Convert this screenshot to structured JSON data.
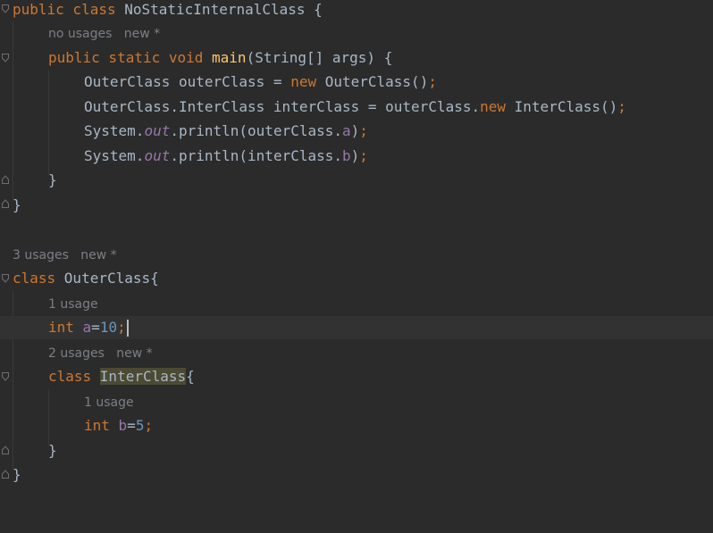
{
  "editor": {
    "colors": {
      "background": "#2b2b2b",
      "keyword": "#cc7832",
      "method": "#ffc66d",
      "field": "#9876aa",
      "number": "#6897bb",
      "text": "#a9b7c6",
      "hint": "#7b7f86"
    },
    "hints": {
      "main_usages": "no usages",
      "main_new": "new *",
      "outer_usages": "3 usages",
      "outer_new": "new *",
      "a_usages": "1 usage",
      "inner_usages": "2 usages",
      "inner_new": "new *",
      "b_usages": "1 usage"
    },
    "code": {
      "l1": {
        "kw": "public class ",
        "name": "NoStaticInternalClass",
        "rest": " {"
      },
      "l2": {
        "kw1": "public static void ",
        "fn": "main",
        "rest": "(String[] args) {"
      },
      "l3": {
        "a": "OuterClass outerClass = ",
        "kw": "new",
        "b": " OuterClass()",
        "semi": ";"
      },
      "l4": {
        "a": "OuterClass.InterClass interClass = outerClass.",
        "kw": "new",
        "b": " InterClass()",
        "semi": ";"
      },
      "l5": {
        "a": "System.",
        "st": "out",
        "b": ".println(outerClass.",
        "fld": "a",
        "c": ")",
        "semi": ";"
      },
      "l6": {
        "a": "System.",
        "st": "out",
        "b": ".println(interClass.",
        "fld": "b",
        "c": ")",
        "semi": ";"
      },
      "l7": "}",
      "l8": "}",
      "l9": {
        "kw": "class ",
        "name": "OuterClass{"
      },
      "l10": {
        "kw": "int ",
        "fld": "a",
        "eq": "=",
        "num": "10",
        "semi": ";"
      },
      "l11": {
        "kw": "class ",
        "name": "InterClass",
        "rest": "{"
      },
      "l12": {
        "kw": "int ",
        "fld": "b",
        "eq": "=",
        "num": "5",
        "semi": ";"
      },
      "l13": "}",
      "l14": "}"
    }
  }
}
